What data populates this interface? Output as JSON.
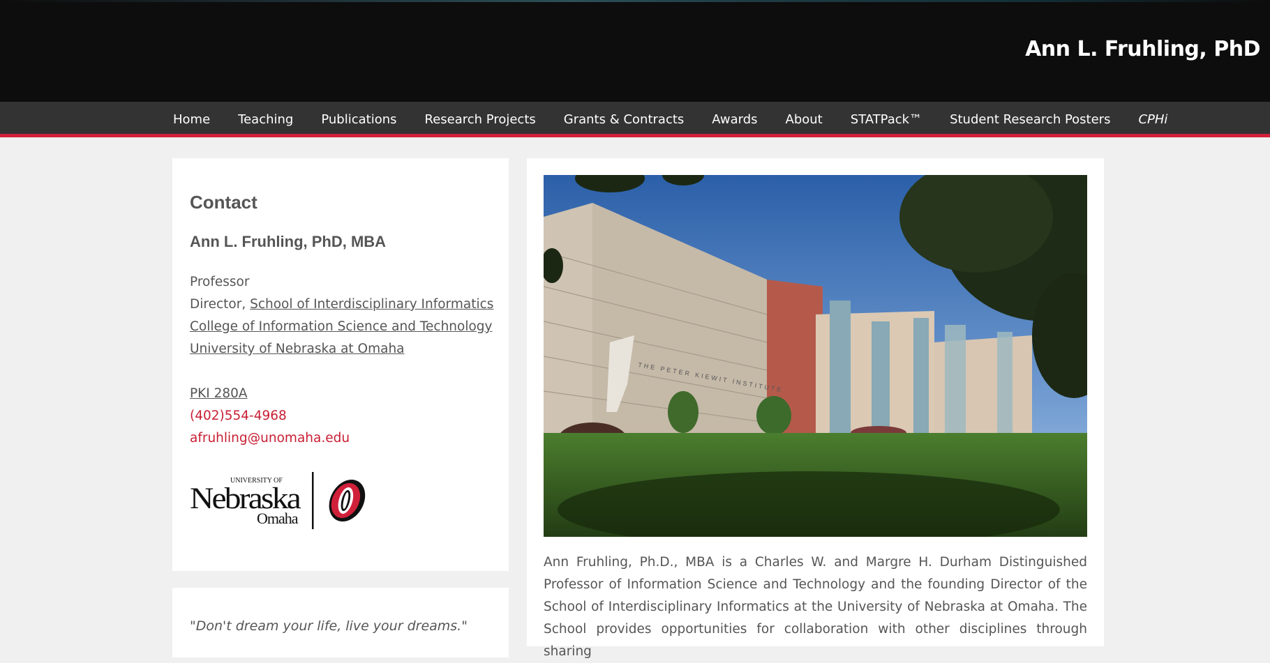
{
  "header": {
    "site_title": "Ann L. Fruhling, PhD"
  },
  "nav": {
    "items": [
      {
        "label": "Home"
      },
      {
        "label": "Teaching"
      },
      {
        "label": "Publications"
      },
      {
        "label": "Research Projects"
      },
      {
        "label": "Grants & Contracts"
      },
      {
        "label": "Awards"
      },
      {
        "label": "About"
      },
      {
        "label": "STATPack™"
      },
      {
        "label": "Student Research Posters"
      },
      {
        "label": "CPHi"
      }
    ]
  },
  "contact": {
    "heading": "Contact",
    "name": "Ann L. Fruhling, PhD, MBA",
    "title": "Professor",
    "director_prefix": "Director, ",
    "school_link": "School of Interdisciplinary Informatics",
    "college_link": "College of Information Science and Technology",
    "university_link": "University of Nebraska at Omaha",
    "office_link": "PKI 280A",
    "phone": "(402)554-4968",
    "email": "afruhling@unomaha.edu",
    "logo": {
      "university_of": "UNIVERSITY OF",
      "nebraska": "Nebraska",
      "omaha": "Omaha",
      "monogram": "O"
    }
  },
  "quote": {
    "text": "\"Don't dream your life, live your dreams.\""
  },
  "main": {
    "photo_sign": "THE PETER KIEWIT INSTITUTE",
    "bio": "Ann Fruhling, Ph.D., MBA is a Charles W. and Margre H. Durham Distinguished Professor of Information Science and Technology and the founding Director of the School of Interdisciplinary Informatics at the University of Nebraska at Omaha. The School provides opportunities for collaboration with other disciplines through sharing"
  },
  "colors": {
    "accent_red": "#d1203a",
    "link_red": "#c81e33",
    "nav_bg": "#333333",
    "header_bg": "#0d0d0d"
  }
}
